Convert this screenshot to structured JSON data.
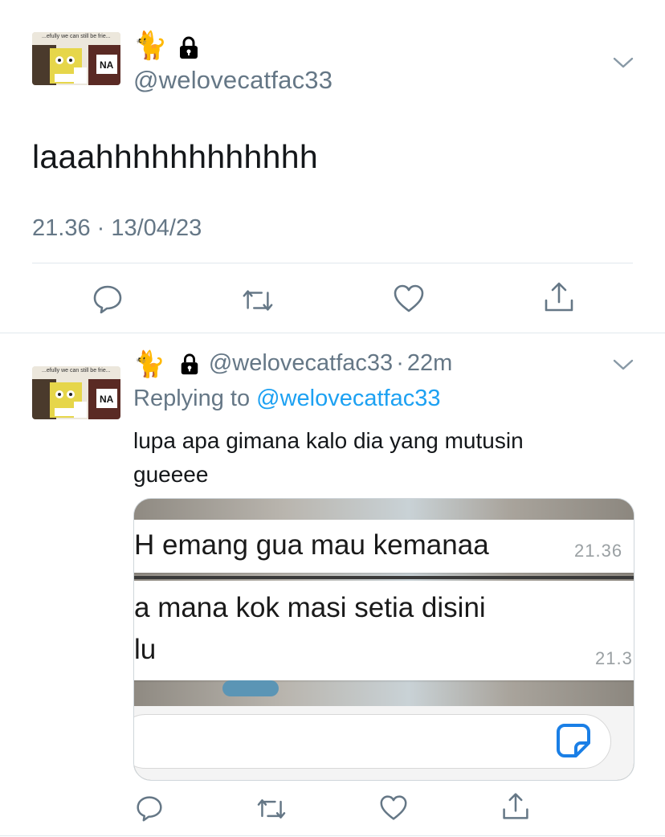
{
  "main_tweet": {
    "avatar_caption": "...efully we can still be frie...",
    "avatar_sign": "NA",
    "name_emoji": "🐈",
    "lock_icon": "lock-icon",
    "handle": "@welovecatfac33",
    "text": "laaahhhhhhhhhhhh",
    "timestamp": "21.36 · 13/04/23"
  },
  "actions": [
    "reply-icon",
    "retweet-icon",
    "like-icon",
    "share-icon"
  ],
  "reply_tweet": {
    "avatar_caption": "...efully we can still be frie...",
    "avatar_sign": "NA",
    "name_emoji": "🐈",
    "handle": "@welovecatfac33",
    "separator": "·",
    "age": "22m",
    "replying_prefix": "Replying to",
    "replying_mention": "@welovecatfac33",
    "text_line1": "lupa apa gimana kalo dia yang mutusin",
    "text_line2": "gueeee",
    "media": {
      "message1_text": "H emang gua mau kemanaa",
      "message1_time": "21.36",
      "message2_line1": "a mana kok masi setia disini",
      "message2_line2": "lu",
      "message2_time": "21.3",
      "sticker_icon": "sticker-icon"
    }
  },
  "colors": {
    "text_primary": "#14171a",
    "text_secondary": "#657786",
    "link": "#1da1f2",
    "divider": "#e1e8ed"
  }
}
